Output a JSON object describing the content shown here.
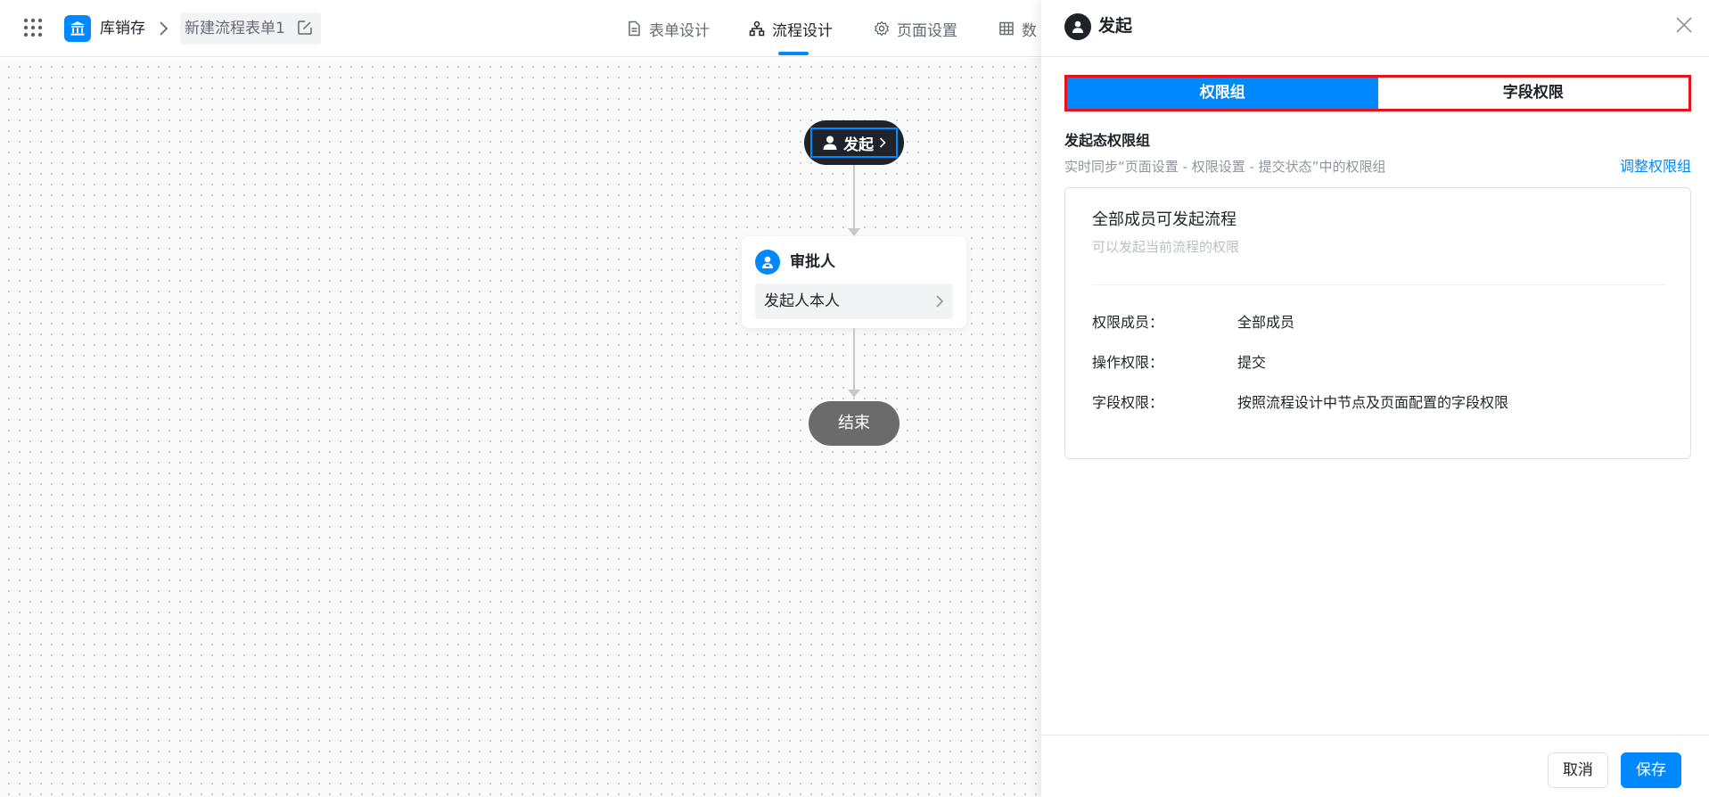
{
  "app": {
    "name": "库销存",
    "form_title": "新建流程表单1",
    "icons": {
      "apps": "grid-dots-icon",
      "logo": "building-icon",
      "separator": "chevron-right-icon",
      "edit": "edit-icon"
    }
  },
  "nav": {
    "tabs": [
      {
        "label": "表单设计",
        "icon": "document-icon",
        "active": false
      },
      {
        "label": "流程设计",
        "icon": "flow-icon",
        "active": true
      },
      {
        "label": "页面设置",
        "icon": "gear-icon",
        "active": false
      },
      {
        "label": "数",
        "icon": "table-icon",
        "active": false
      }
    ]
  },
  "flow": {
    "start_label": "发起",
    "approver_title": "审批人",
    "approver_value": "发起人本人",
    "end_label": "结束"
  },
  "panel": {
    "title": "发起",
    "tabs": [
      {
        "label": "权限组",
        "active": true
      },
      {
        "label": "字段权限",
        "active": false
      }
    ],
    "section_title": "发起态权限组",
    "section_desc": "实时同步“页面设置 - 权限设置 - 提交状态”中的权限组",
    "adjust_link": "调整权限组",
    "group": {
      "name": "全部成员可发起流程",
      "description": "可以发起当前流程的权限",
      "rows": [
        {
          "label": "权限成员：",
          "value": "全部成员"
        },
        {
          "label": "操作权限：",
          "value": "提交"
        },
        {
          "label": "字段权限：",
          "value": "按照流程设计中节点及页面配置的字段权限"
        }
      ]
    },
    "footer": {
      "cancel": "取消",
      "save": "保存"
    }
  },
  "colors": {
    "primary": "#0089ff",
    "highlight_border": "#e3151b",
    "start_node": "#1f2329",
    "end_node": "#6b6b6b"
  }
}
